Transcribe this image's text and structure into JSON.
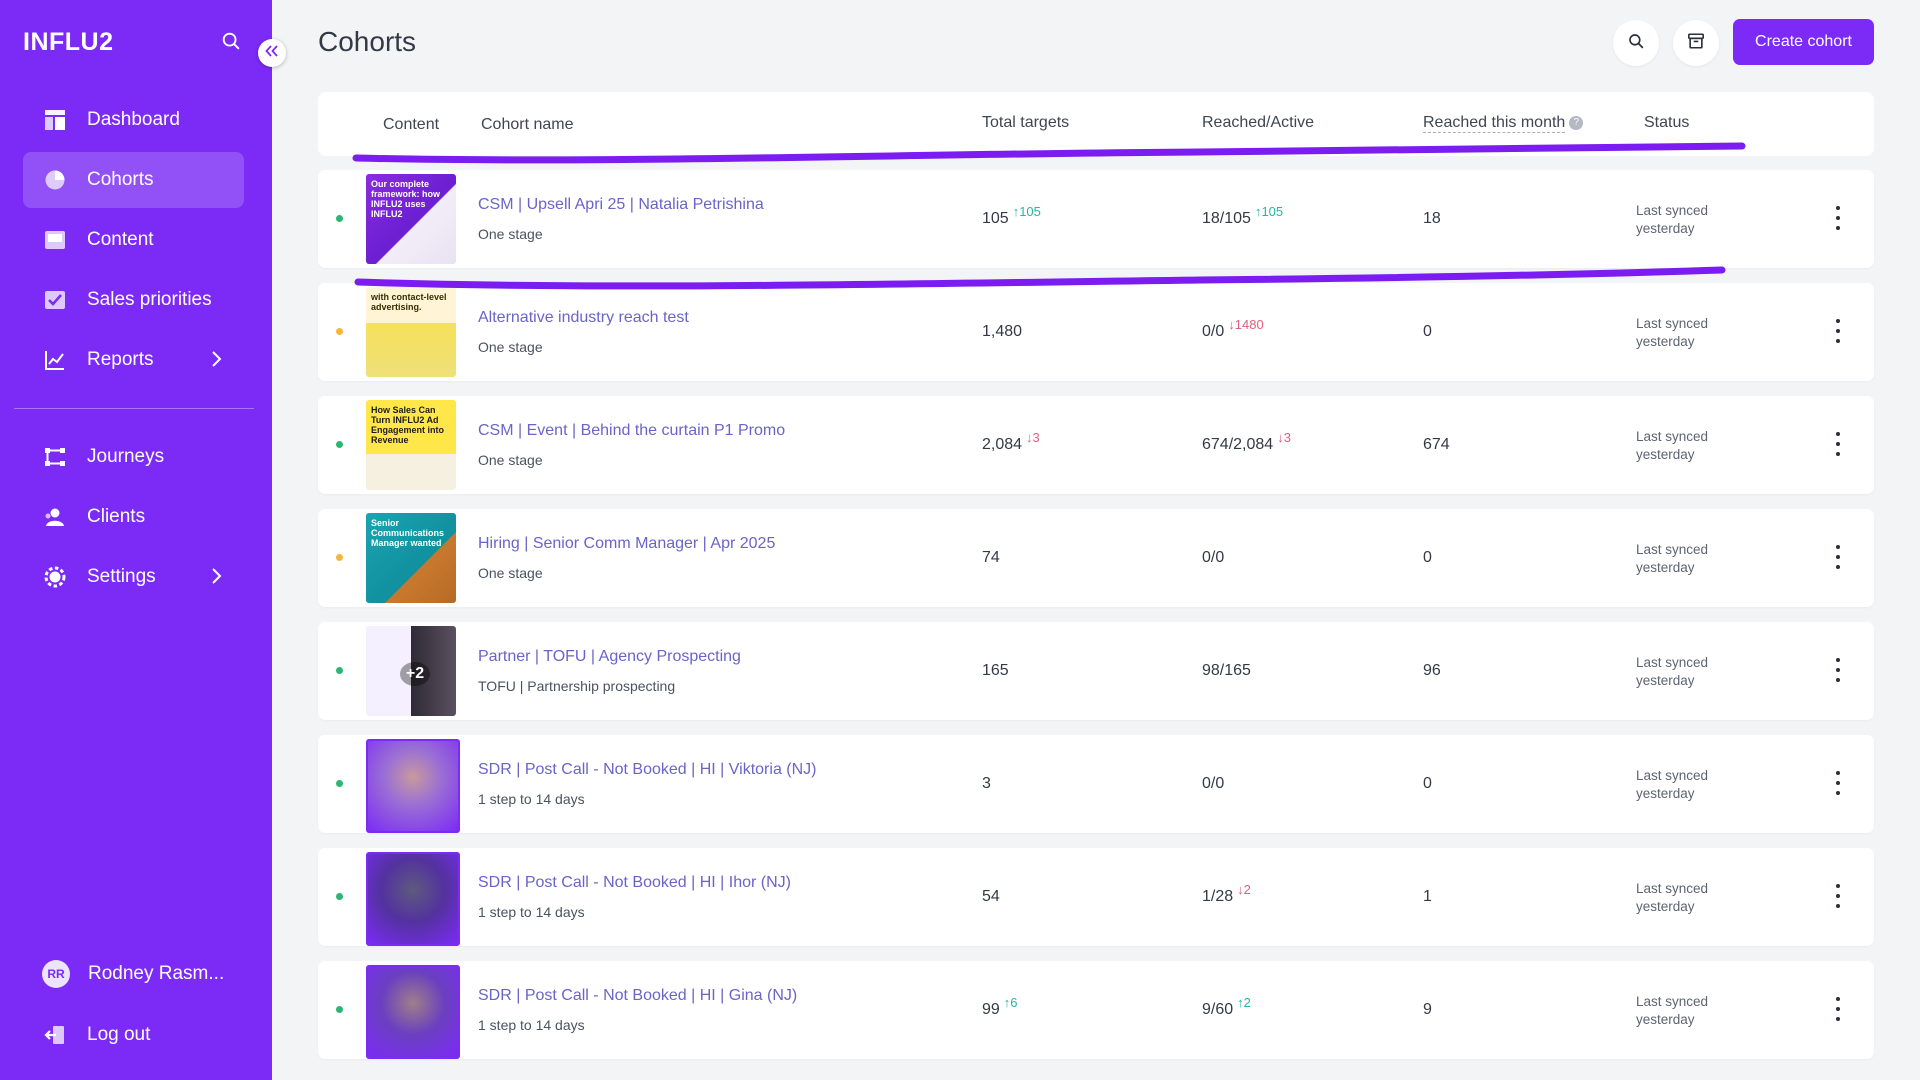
{
  "app": {
    "logo": "INFLU2"
  },
  "sidebar": {
    "items": [
      {
        "label": "Dashboard",
        "icon": "dashboard-icon"
      },
      {
        "label": "Cohorts",
        "icon": "pie-chart-icon",
        "active": true
      },
      {
        "label": "Content",
        "icon": "content-icon"
      },
      {
        "label": "Sales priorities",
        "icon": "checkbox-icon"
      },
      {
        "label": "Reports",
        "icon": "line-chart-icon",
        "has_submenu": true
      },
      {
        "label": "Journeys",
        "icon": "journeys-icon"
      },
      {
        "label": "Clients",
        "icon": "clients-icon"
      },
      {
        "label": "Settings",
        "icon": "gear-icon",
        "has_submenu": true
      }
    ],
    "user": {
      "initials": "RR",
      "name": "Rodney Rasm..."
    },
    "logout_label": "Log out"
  },
  "header": {
    "title": "Cohorts",
    "create_label": "Create cohort"
  },
  "table": {
    "columns": {
      "content": "Content",
      "name": "Cohort name",
      "total": "Total targets",
      "reached": "Reached/Active",
      "month": "Reached this month",
      "status": "Status"
    },
    "rows": [
      {
        "name": "CSM | Upsell Apri 25 | Natalia Petrishina",
        "sub": "One stage",
        "total": "105",
        "total_delta": "↑105",
        "reached": "18/105",
        "reached_delta": "↑105",
        "month": "18",
        "status_l1": "Last synced",
        "status_l2": "yesterday",
        "dot": "#2bb673",
        "thumb_text": "Our complete framework: how INFLU2 uses INFLU2"
      },
      {
        "name": "Alternative industry reach test",
        "sub": "One stage",
        "total": "1,480",
        "total_delta": "",
        "reached": "0/0",
        "reached_delta": "↓1480",
        "month": "0",
        "status_l1": "Last synced",
        "status_l2": "yesterday",
        "dot": "#f5b63a",
        "thumb_text": "with contact-level advertising."
      },
      {
        "name": "CSM | Event | Behind the curtain P1 Promo",
        "sub": "One stage",
        "total": "2,084",
        "total_delta": "↓3",
        "reached": "674/2,084",
        "reached_delta": "↓3",
        "month": "674",
        "status_l1": "Last synced",
        "status_l2": "yesterday",
        "dot": "#2bb673",
        "thumb_text": "How Sales Can Turn INFLU2 Ad Engagement into Revenue"
      },
      {
        "name": "Hiring | Senior Comm Manager | Apr 2025",
        "sub": "One stage",
        "total": "74",
        "total_delta": "",
        "reached": "0/0",
        "reached_delta": "",
        "month": "0",
        "status_l1": "Last synced",
        "status_l2": "yesterday",
        "dot": "#f5b63a",
        "thumb_text": "Senior Communications Manager wanted"
      },
      {
        "name": "Partner | TOFU | Agency Prospecting",
        "sub": "TOFU | Partnership prospecting",
        "total": "165",
        "total_delta": "",
        "reached": "98/165",
        "reached_delta": "",
        "month": "96",
        "status_l1": "Last synced",
        "status_l2": "yesterday",
        "dot": "#2bb673",
        "thumb_text": "+2"
      },
      {
        "name": "SDR | Post Call - Not Booked | HI | Viktoria (NJ)",
        "sub": "1 step to 14 days",
        "total": "3",
        "total_delta": "",
        "reached": "0/0",
        "reached_delta": "",
        "month": "0",
        "status_l1": "Last synced",
        "status_l2": "yesterday",
        "dot": "#2bb673",
        "thumb_text": ""
      },
      {
        "name": "SDR | Post Call - Not Booked | HI | Ihor (NJ)",
        "sub": "1 step to 14 days",
        "total": "54",
        "total_delta": "",
        "reached": "1/28",
        "reached_delta": "↓2",
        "month": "1",
        "status_l1": "Last synced",
        "status_l2": "yesterday",
        "dot": "#2bb673",
        "thumb_text": ""
      },
      {
        "name": "SDR | Post Call - Not Booked | HI | Gina (NJ)",
        "sub": "1 step to 14 days",
        "total": "99",
        "total_delta": "↑6",
        "reached": "9/60",
        "reached_delta": "↑2",
        "month": "9",
        "status_l1": "Last synced",
        "status_l2": "yesterday",
        "dot": "#2bb673",
        "thumb_text": ""
      }
    ]
  },
  "colors": {
    "brand": "#7b2bf5",
    "up": "#23b8a5",
    "down": "#e0607e",
    "link": "#6a64c8"
  }
}
